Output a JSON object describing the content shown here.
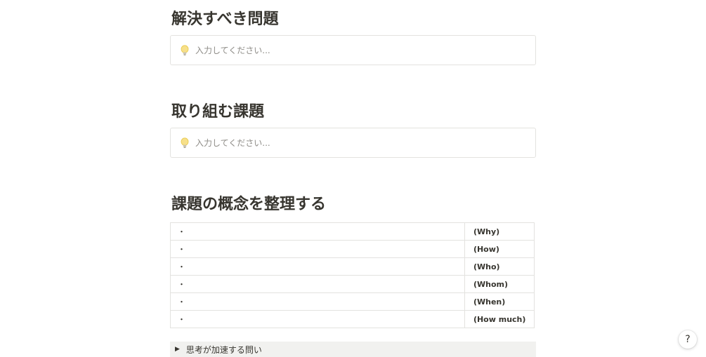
{
  "sections": [
    {
      "heading": "解決すべき問題",
      "callout": {
        "icon": "lightbulb-icon",
        "placeholder": "入力してください..."
      }
    },
    {
      "heading": "取り組む課題",
      "callout": {
        "icon": "lightbulb-icon",
        "placeholder": "入力してください..."
      }
    },
    {
      "heading": "課題の概念を整理する"
    }
  ],
  "concept_table": {
    "rows": [
      {
        "bullet": "・",
        "label": "(Why)"
      },
      {
        "bullet": "・",
        "label": "(How)"
      },
      {
        "bullet": "・",
        "label": "(Who)"
      },
      {
        "bullet": "・",
        "label": "(Whom)"
      },
      {
        "bullet": "・",
        "label": "(When)"
      },
      {
        "bullet": "・",
        "label": "(How much)"
      }
    ]
  },
  "toggle": {
    "icon": "triangle-right-icon",
    "label": "思考が加速する問い"
  },
  "help_button": {
    "label": "?"
  }
}
